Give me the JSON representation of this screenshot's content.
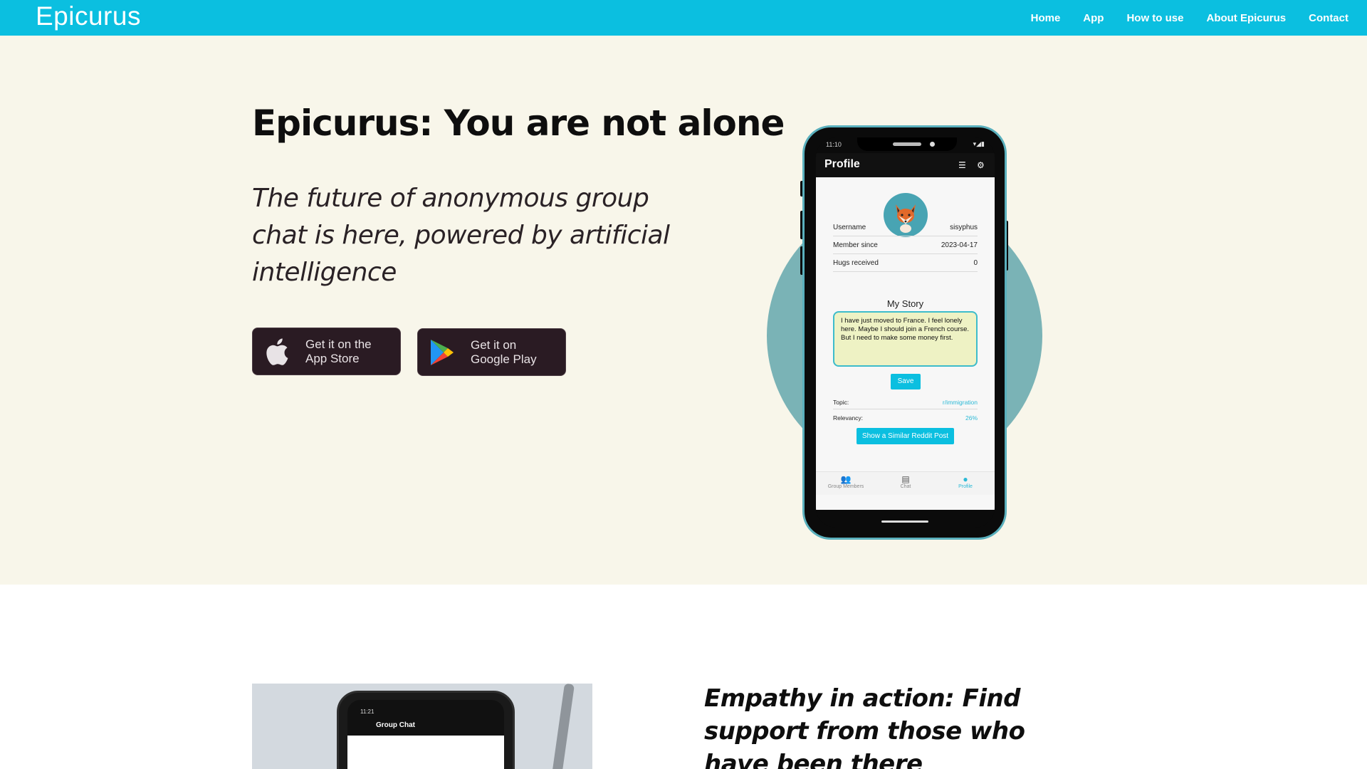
{
  "navbar": {
    "brand": "Epicurus",
    "links": [
      "Home",
      "App",
      "How to use",
      "About Epicurus",
      "Contact"
    ]
  },
  "hero": {
    "title": "Epicurus: You are not alone",
    "subtitle": "The future of anonymous group chat is here, powered by artificial intelligence",
    "app_store": {
      "line1": "Get it on the",
      "line2": "App Store",
      "icon": "apple-icon"
    },
    "google_play": {
      "line1": "Get it on",
      "line2": "Google Play",
      "icon": "google-play-icon"
    }
  },
  "phone": {
    "time": "11:10",
    "screen_title": "Profile",
    "header_icons": [
      "checklist-icon",
      "gear-icon"
    ],
    "profile": {
      "rows": [
        {
          "label": "Username",
          "value": "sisyphus"
        },
        {
          "label": "Member since",
          "value": "2023-04-17"
        },
        {
          "label": "Hugs received",
          "value": "0"
        }
      ],
      "story_title": "My Story",
      "story_text": "I have just moved to France. I feel lonely here. Maybe I should join a French course. But I need to make some money first.",
      "save_label": "Save",
      "topic_label": "Topic:",
      "topic_value": "r/immigration",
      "relevancy_label": "Relevancy:",
      "relevancy_value": "26%",
      "reddit_button": "Show a Similar Reddit Post"
    },
    "tabs": [
      {
        "label": "Group Members",
        "icon": "group-icon"
      },
      {
        "label": "Chat",
        "icon": "chat-icon"
      },
      {
        "label": "Profile",
        "icon": "profile-icon"
      }
    ],
    "active_tab": "Profile"
  },
  "section2": {
    "heading": "Empathy in action: Find support from those who have been there",
    "photo": {
      "time": "11:21",
      "chat_title": "Group Chat"
    }
  },
  "colors": {
    "accent": "#0bbfe0",
    "hero_bg": "#f8f6ea",
    "button_bg": "#2a1b23",
    "circle": "#7ab3b6"
  }
}
